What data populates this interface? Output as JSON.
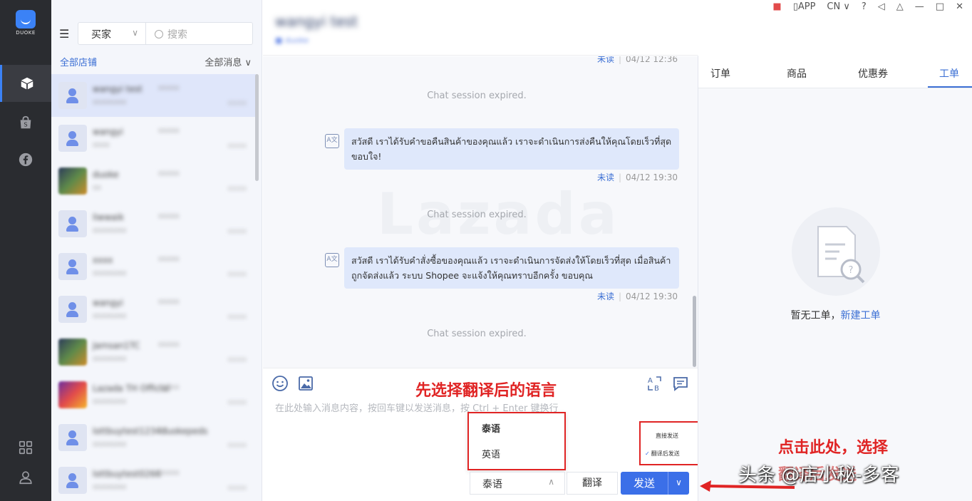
{
  "rail": {
    "logo_text": "DUOKE"
  },
  "list": {
    "role_select": "买家",
    "search_placeholder": "搜索",
    "all_stores": "全部店铺",
    "all_messages": "全部消息"
  },
  "chat": {
    "expired": "Chat session expired.",
    "watermark": "Lazada",
    "top_meta_time": "04/12 12:36",
    "messages": [
      {
        "text": "สวัสดี เราได้รับคำขอคืนสินค้าของคุณแล้ว เราจะดำเนินการส่งคืนให้คุณโดยเร็วที่สุด ขอบใจ!",
        "status": "未读",
        "time": "04/12 19:30"
      },
      {
        "text": "สวัสดี เราได้รับคำสั่งซื้อของคุณแล้ว เราจะดำเนินการจัดส่งให้โดยเร็วที่สุด เมื่อสินค้าถูกจัดส่งแล้ว ระบบ Shopee จะแจ้งให้คุณทราบอีกครั้ง ขอบคุณ",
        "status": "未读",
        "time": "04/12 19:30"
      }
    ],
    "unread_label": "未读",
    "input_placeholder": "在此处输入消息内容，按回车键以发送消息，按 Ctrl + Enter 键换行",
    "language_selected": "泰语",
    "language_options": [
      "泰语",
      "英语"
    ],
    "translate_button": "翻译",
    "send_button": "发送",
    "send_options": [
      "直接发送",
      "翻译后发送"
    ]
  },
  "panel": {
    "tabs": [
      "订单",
      "商品",
      "优惠券",
      "工单"
    ],
    "active_tab": "工单",
    "empty_text": "暂无工单，",
    "empty_link": "新建工单"
  },
  "topbar": {
    "app": "APP",
    "lang": "CN"
  },
  "annotations": {
    "select_language": "先选择翻译后的语言",
    "click_here": "点击此处，选择",
    "translate_send": "翻译后发送",
    "credit": "头条 @店小秘-多客"
  },
  "colors": {
    "accent": "#3b6fe8",
    "annotation": "#e02424",
    "rail": "#2a2c30"
  }
}
